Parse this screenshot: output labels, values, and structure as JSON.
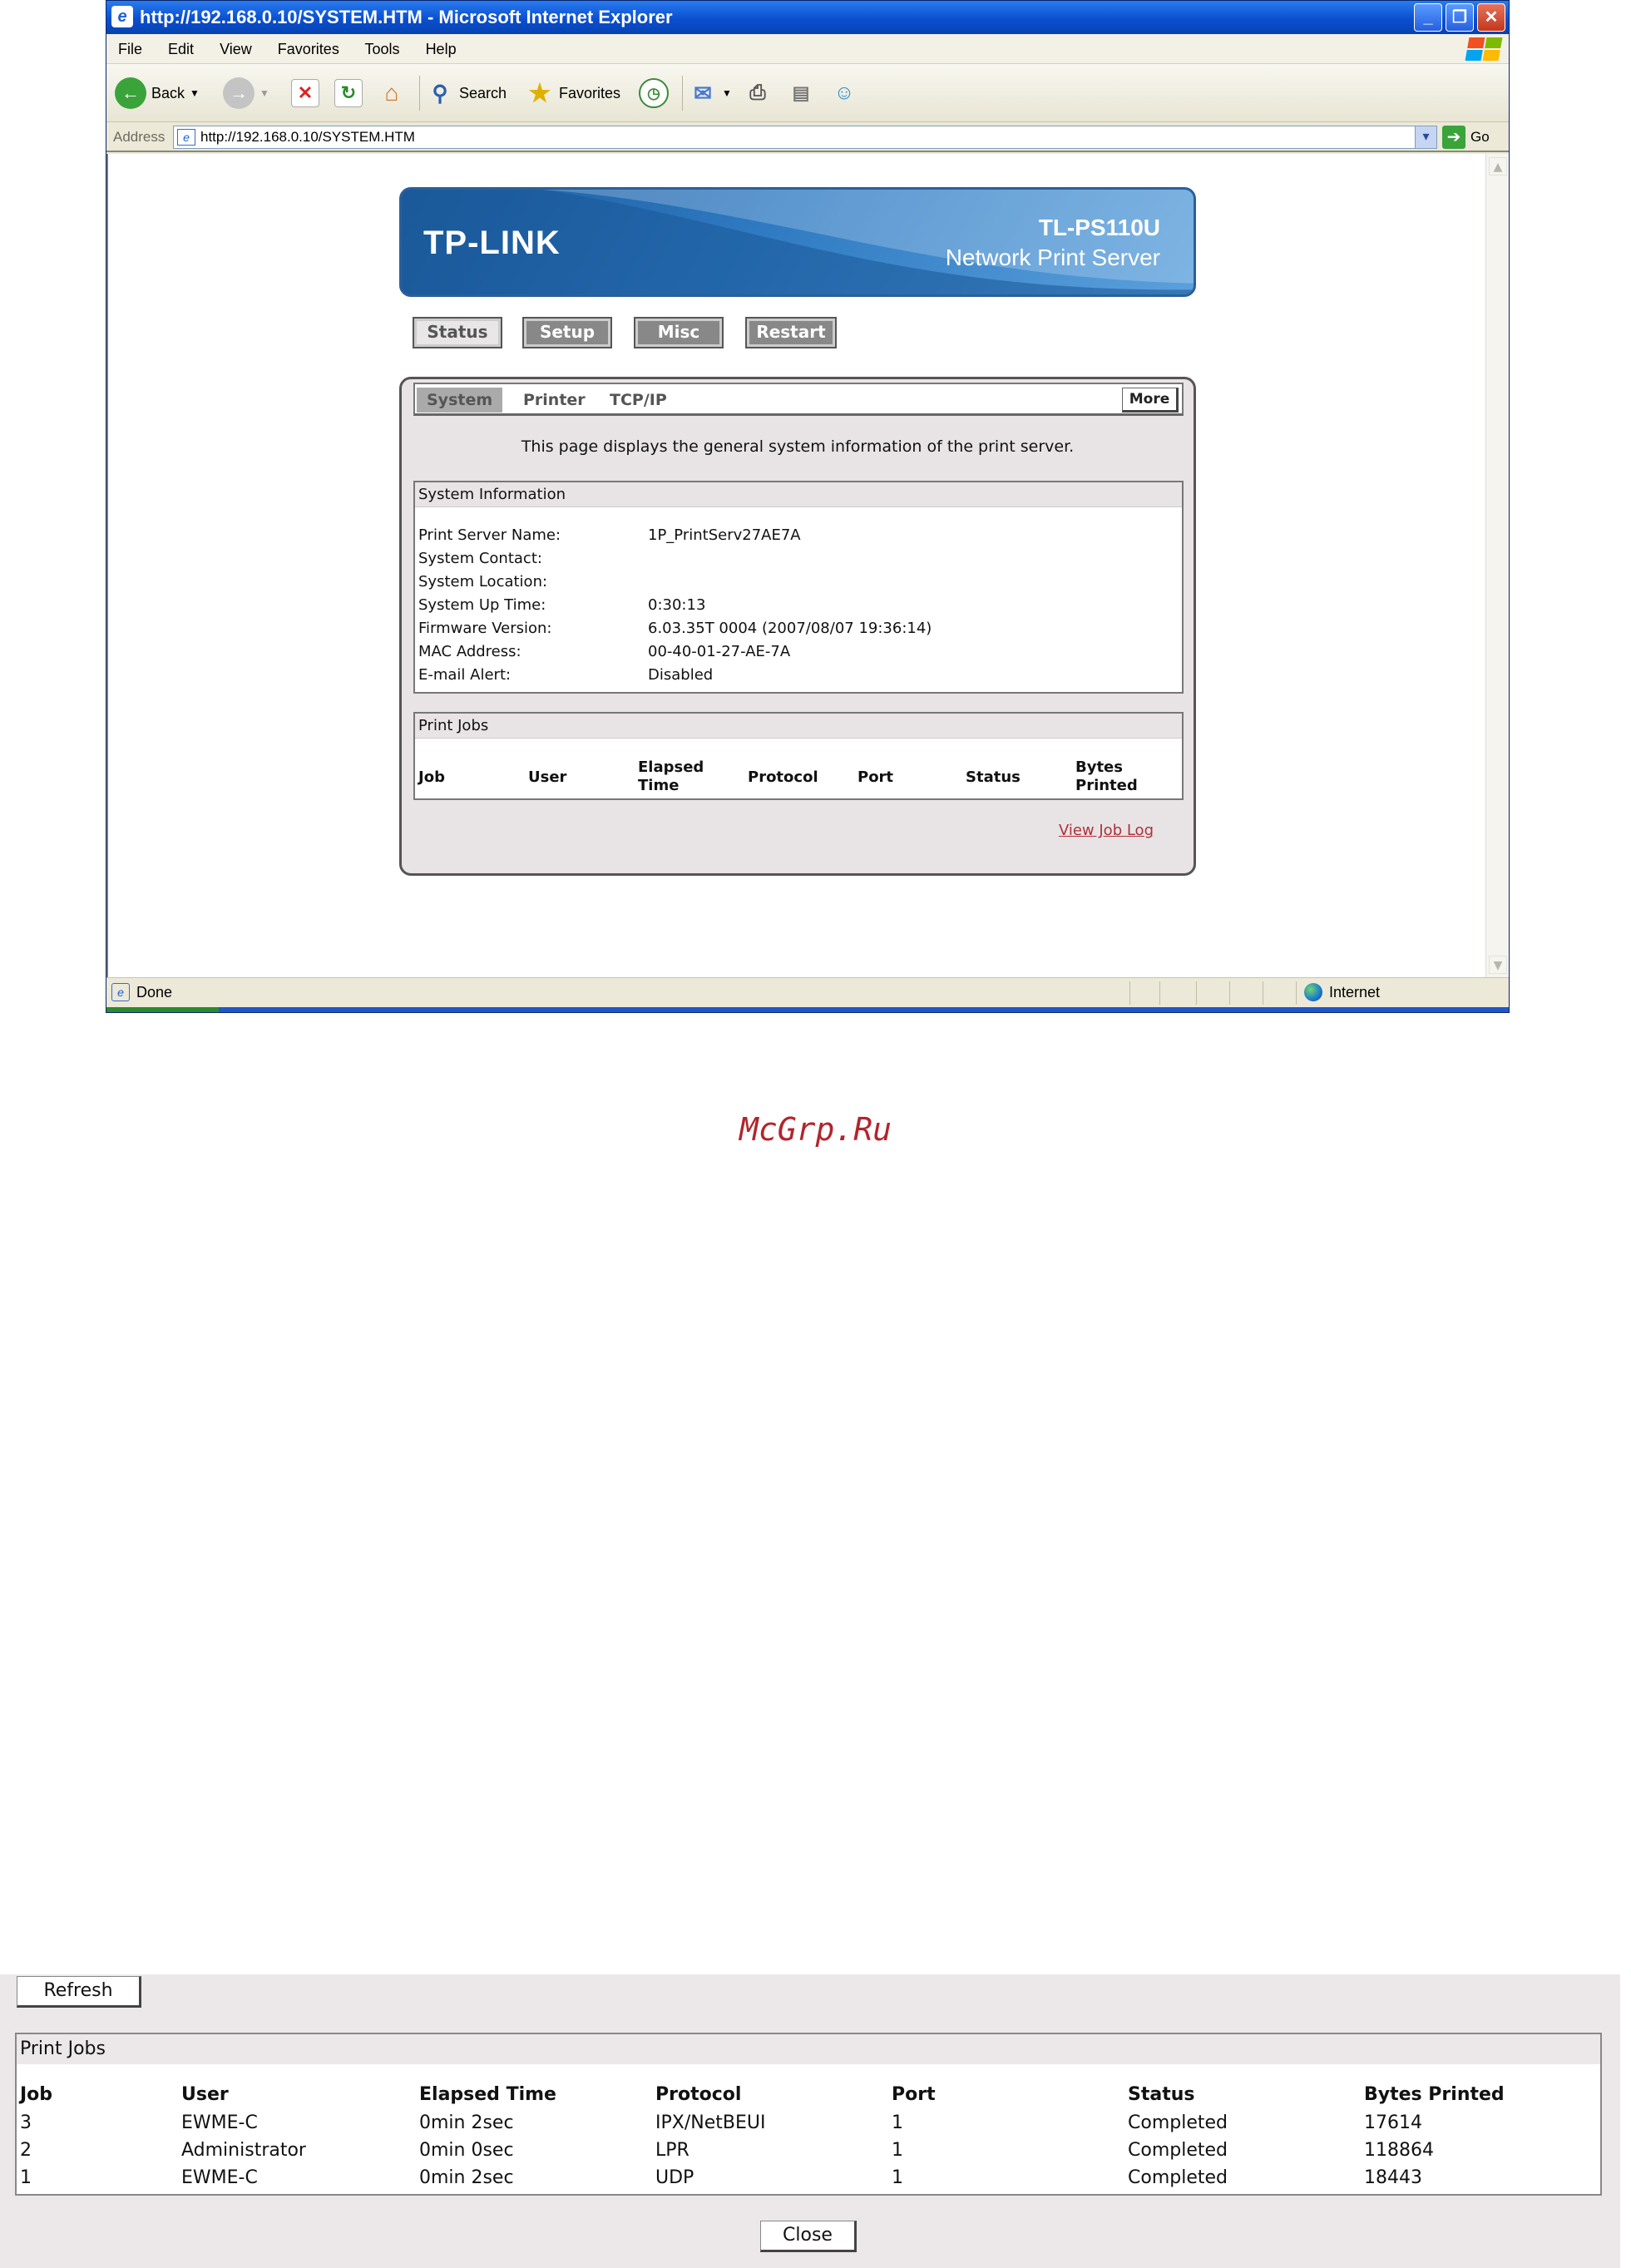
{
  "window": {
    "title": "http://192.168.0.10/SYSTEM.HTM - Microsoft Internet Explorer",
    "minimize": "_",
    "restore": "❐",
    "close": "✕"
  },
  "menu": [
    "File",
    "Edit",
    "View",
    "Favorites",
    "Tools",
    "Help"
  ],
  "toolbar": {
    "back_label": "Back",
    "search_label": "Search",
    "favorites_label": "Favorites"
  },
  "address": {
    "label": "Address",
    "url": "http://192.168.0.10/SYSTEM.HTM",
    "go_label": "Go"
  },
  "statusbar": {
    "status": "Done",
    "zone": "Internet"
  },
  "banner": {
    "brand": "TP-LINK",
    "model": "TL-PS110U",
    "product": "Network Print Server"
  },
  "nav": {
    "status": "Status",
    "setup": "Setup",
    "misc": "Misc",
    "restart": "Restart"
  },
  "subtabs": {
    "system": "System",
    "printer": "Printer",
    "tcpip": "TCP/IP",
    "more": "More"
  },
  "intro": "This page displays the general system information of the print server.",
  "system_info": {
    "title": "System Information",
    "rows": [
      {
        "label": "Print Server Name:",
        "value": "1P_PrintServ27AE7A"
      },
      {
        "label": "System Contact:",
        "value": ""
      },
      {
        "label": "System Location:",
        "value": ""
      },
      {
        "label": "System Up Time:",
        "value": "0:30:13"
      },
      {
        "label": "Firmware Version:",
        "value": "6.03.35T 0004 (2007/08/07 19:36:14)"
      },
      {
        "label": "MAC Address:",
        "value": "00-40-01-27-AE-7A"
      },
      {
        "label": "E-mail Alert:",
        "value": "Disabled"
      }
    ]
  },
  "print_jobs": {
    "title": "Print Jobs",
    "headers": [
      "Job",
      "User",
      "Elapsed Time",
      "Protocol",
      "Port",
      "Status",
      "Bytes Printed"
    ],
    "view_log": "View Job Log"
  },
  "watermark": "McGrp.Ru",
  "job_log": {
    "refresh": "Refresh",
    "title": "Print Jobs",
    "headers": [
      "Job",
      "User",
      "Elapsed Time",
      "Protocol",
      "Port",
      "Status",
      "Bytes Printed"
    ],
    "rows": [
      [
        "3",
        "EWME-C",
        "0min 2sec",
        "IPX/NetBEUI",
        "1",
        "Completed",
        "17614"
      ],
      [
        "2",
        "Administrator",
        "0min 0sec",
        "LPR",
        "1",
        "Completed",
        "118864"
      ],
      [
        "1",
        "EWME-C",
        "0min 2sec",
        "UDP",
        "1",
        "Completed",
        "18443"
      ]
    ],
    "close": "Close"
  },
  "colors": {
    "titlebar": "#0a4fd0",
    "banner": "#2f7ac2",
    "link": "#b0303a",
    "watermark": "#b2252c"
  }
}
